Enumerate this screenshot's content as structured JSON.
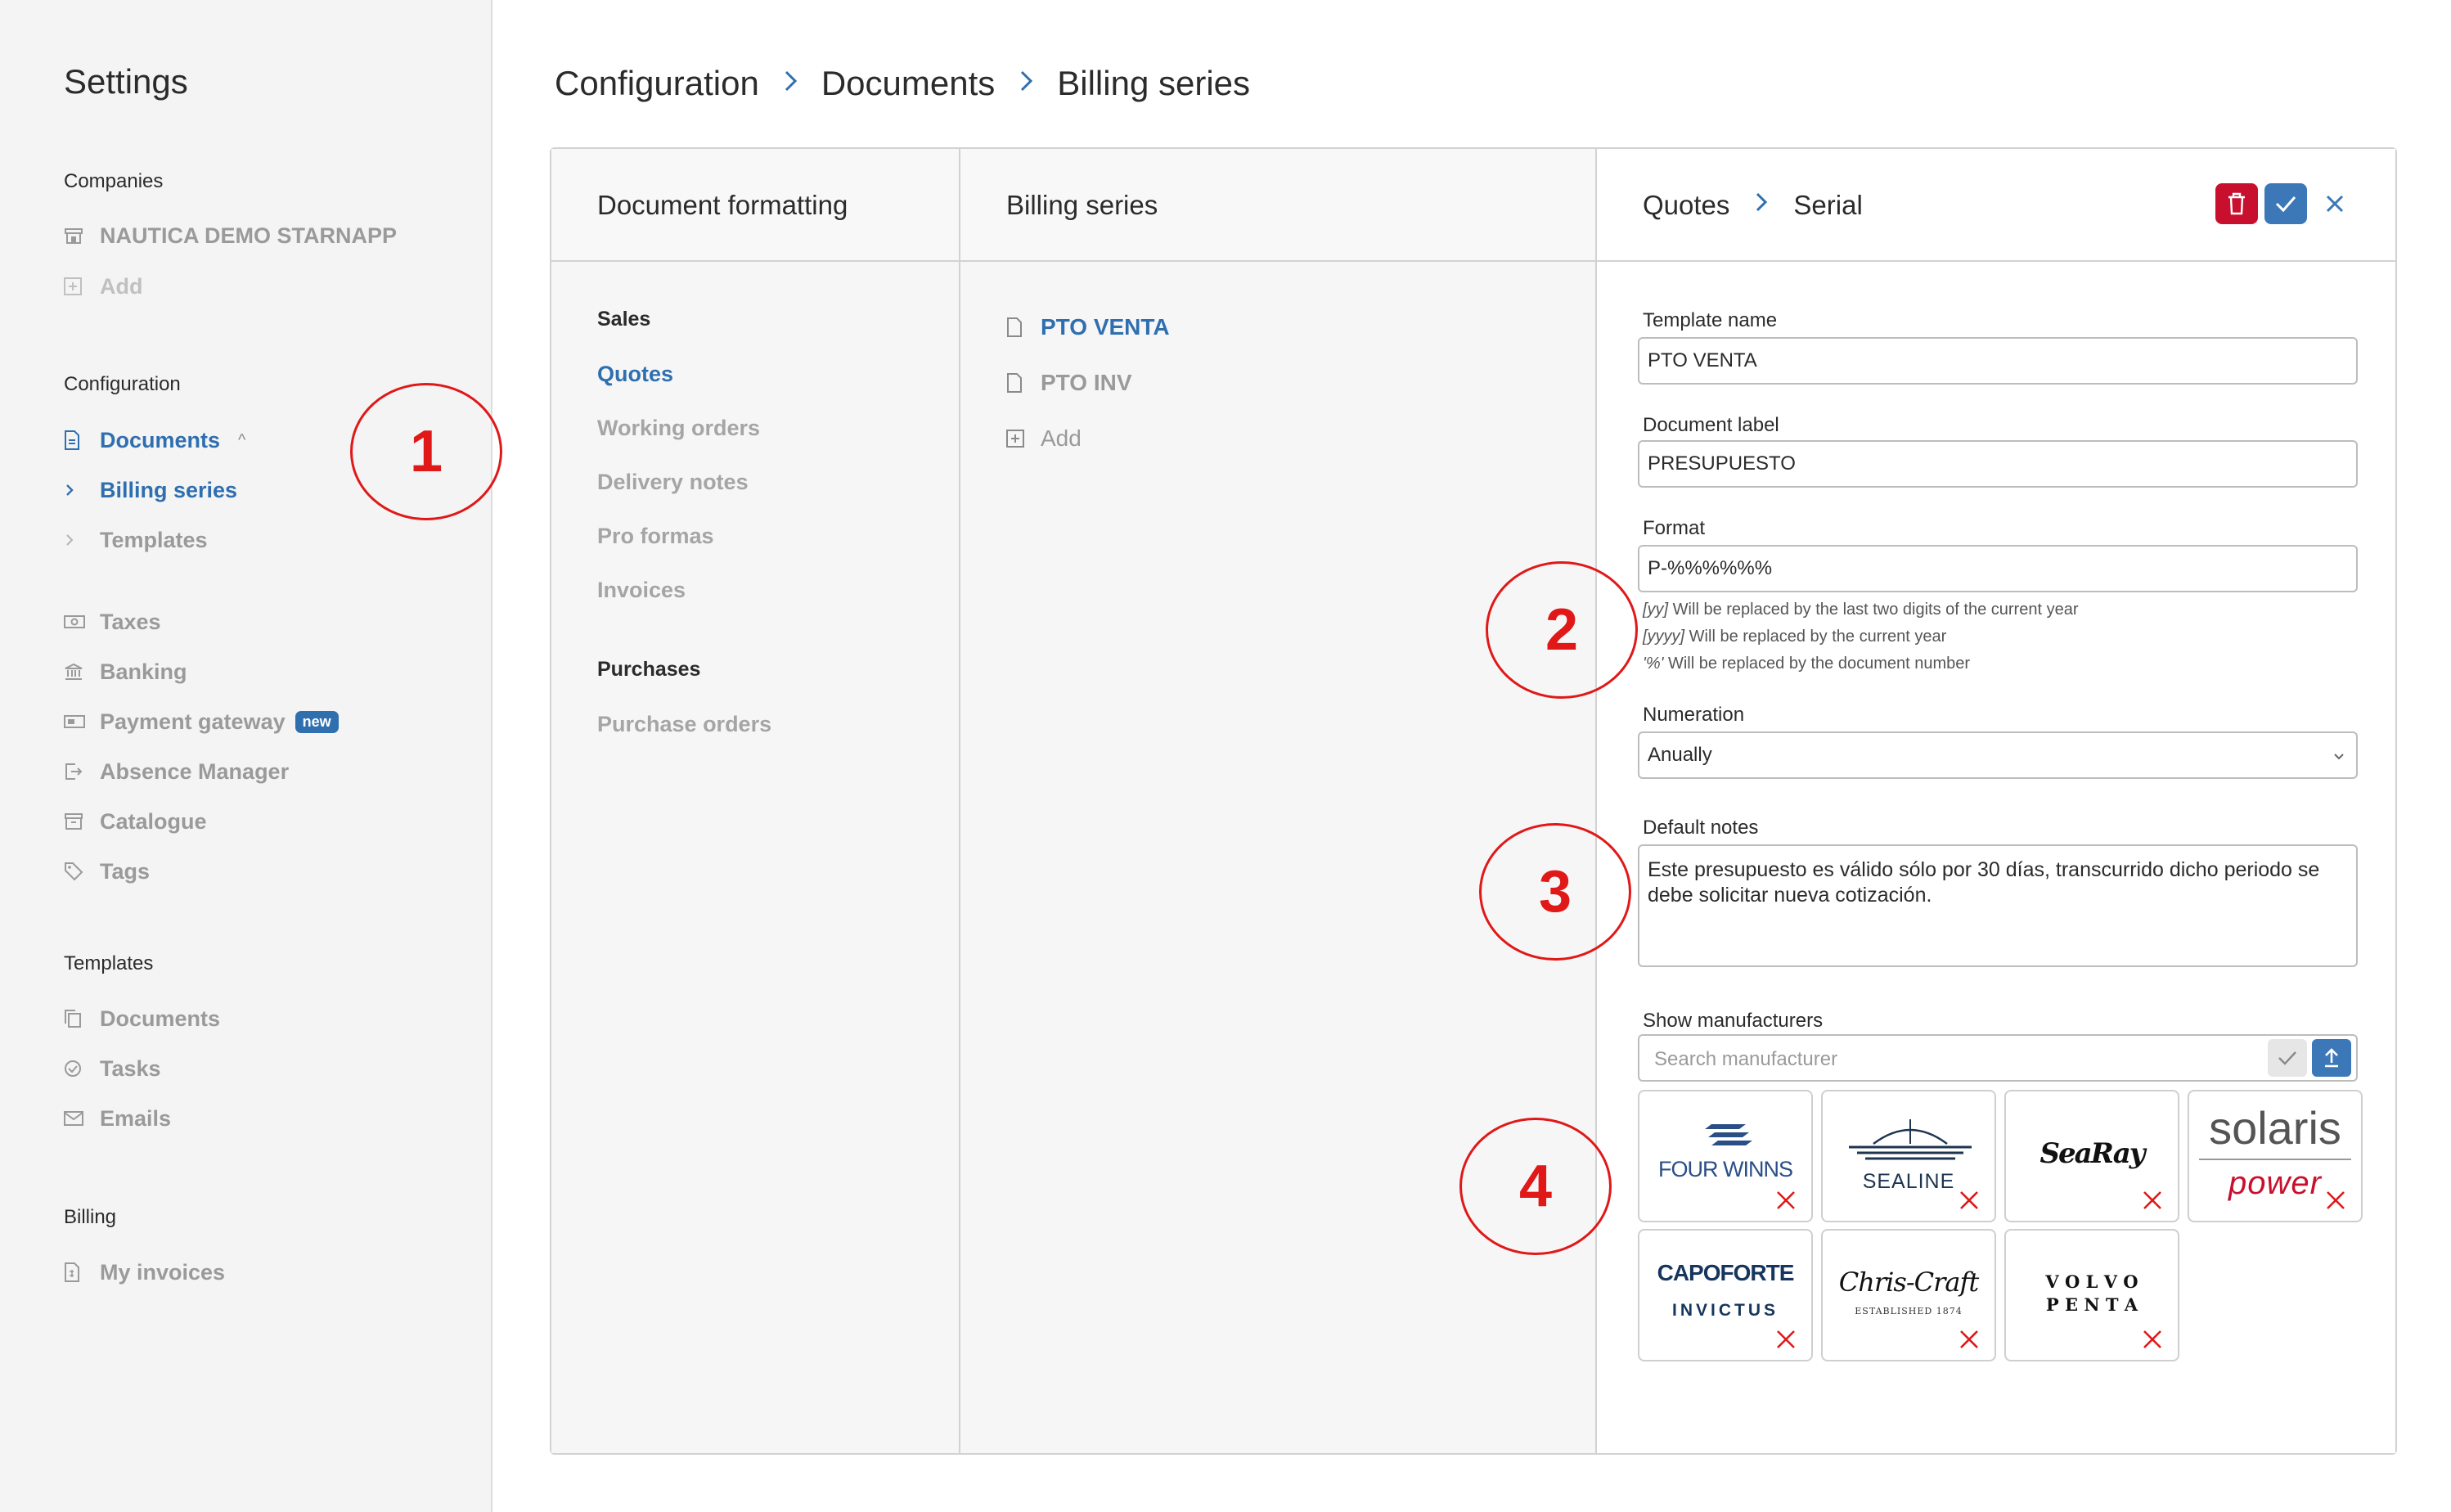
{
  "sidebar": {
    "title": "Settings",
    "companies_label": "Companies",
    "company_name": "NAUTICA DEMO STARNAPP",
    "add_label": "Add",
    "configuration_label": "Configuration",
    "documents_label": "Documents",
    "billing_series_label": "Billing series",
    "templates_sub_label": "Templates",
    "taxes_label": "Taxes",
    "banking_label": "Banking",
    "payment_gateway_label": "Payment gateway",
    "new_badge": "new",
    "absence_label": "Absence Manager",
    "catalogue_label": "Catalogue",
    "tags_label": "Tags",
    "templates_label": "Templates",
    "tpl_documents_label": "Documents",
    "tpl_tasks_label": "Tasks",
    "tpl_emails_label": "Emails",
    "billing_label": "Billing",
    "my_invoices_label": "My invoices"
  },
  "breadcrumb": [
    "Configuration",
    "Documents",
    "Billing series"
  ],
  "formatting": {
    "title": "Document formatting",
    "sales_label": "Sales",
    "items": [
      "Quotes",
      "Working orders",
      "Delivery notes",
      "Pro formas",
      "Invoices"
    ],
    "purchases_label": "Purchases",
    "purchase_items": [
      "Purchase orders"
    ]
  },
  "billing_series": {
    "title": "Billing series",
    "items": [
      "PTO VENTA",
      "PTO INV"
    ],
    "add_label": "Add"
  },
  "editor": {
    "crumb_parent": "Quotes",
    "crumb_current": "Serial",
    "template_name_label": "Template name",
    "template_name_value": "PTO VENTA",
    "document_label_label": "Document label",
    "document_label_value": "PRESUPUESTO",
    "format_label": "Format",
    "format_value": "P-%%%%%%",
    "hint1_code": "[yy]",
    "hint1_text": " Will be replaced by the last two digits of the current year",
    "hint2_code": "[yyyy]",
    "hint2_text": " Will be replaced by the current year",
    "hint3_code": "'%'",
    "hint3_text": " Will be replaced by the document number",
    "numeration_label": "Numeration",
    "numeration_value": "Anually",
    "default_notes_label": "Default notes",
    "default_notes_value": "Este presupuesto es válido sólo por 30 días, transcurrido dicho periodo se debe solicitar nueva cotización.",
    "show_manufacturers_label": "Show manufacturers",
    "search_placeholder": "Search manufacturer",
    "manufacturers": {
      "fourwinns": "FOUR WINNS",
      "sealine": "SEALINE",
      "searay": "SeaRay",
      "solaris": "solaris",
      "solaris_sub": "power",
      "capoforte": "CAPOFORTE",
      "capoforte_sub": "INVICTUS",
      "chriscraft": "Chris-Craft",
      "chriscraft_sub": "ESTABLISHED 1874",
      "volvo_line1": "V O L V O",
      "volvo_line2": "P E N T A"
    }
  },
  "annotations": [
    "1",
    "2",
    "3",
    "4"
  ],
  "colors": {
    "accent": "#2f6fb0",
    "danger": "#c8102e",
    "annotation": "#e01818"
  }
}
